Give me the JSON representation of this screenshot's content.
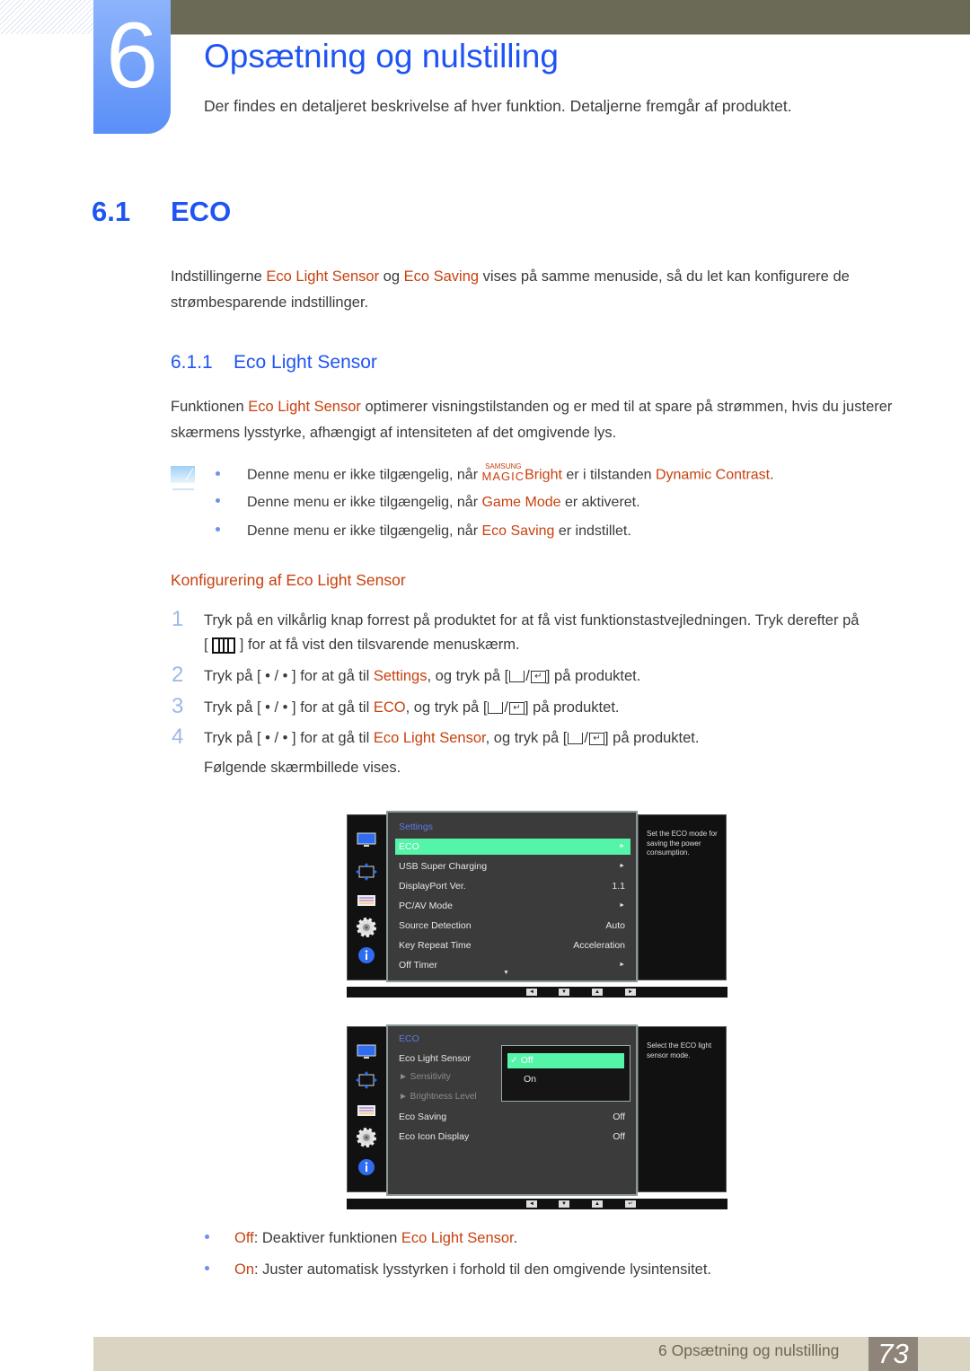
{
  "chapter": {
    "number": "6",
    "title": "Opsætning og nulstilling",
    "intro": "Der findes en detaljeret beskrivelse af hver funktion. Detaljerne fremgår af produktet."
  },
  "section": {
    "number": "6.1",
    "title": "ECO",
    "para": {
      "p1": "Indstillingerne ",
      "h1": "Eco Light Sensor",
      "p2": " og ",
      "h2": "Eco Saving",
      "p3": " vises på samme menuside, så du let kan konfigurere de strømbesparende indstillinger."
    }
  },
  "subsection": {
    "number": "6.1.1",
    "title": "Eco Light Sensor",
    "para": {
      "p1": "Funktionen ",
      "h1": "Eco Light Sensor",
      "p2": " optimerer visningstilstanden og er med til at spare på strømmen, hvis du justerer skærmens lysstyrke, afhængigt af intensiteten af det omgivende lys."
    }
  },
  "notes": [
    {
      "pre": "Denne menu er ikke tilgængelig, når ",
      "magic_top": "SAMSUNG",
      "magic_bottom": "MAGIC",
      "hl1": "Bright",
      "mid": " er i tilstanden ",
      "hl2": "Dynamic Contrast",
      "post": "."
    },
    {
      "pre": "Denne menu er ikke tilgængelig, når ",
      "hl1": "Game Mode",
      "post": " er aktiveret."
    },
    {
      "pre": "Denne menu er ikke tilgængelig, når ",
      "hl1": "Eco Saving",
      "post": " er indstillet."
    }
  ],
  "config": {
    "heading": "Konfigurering af Eco Light Sensor",
    "steps": [
      {
        "num": "1",
        "line1": "Tryk på en vilkårlig knap forrest på produktet for at få vist funktionstastvejledningen. Tryk derefter på",
        "line2_pre": "[",
        "line2_post": "] for at få vist den tilsvarende menuskærm."
      },
      {
        "num": "2",
        "pre": "Tryk på [ • / • ] for at gå til ",
        "hl": "Settings",
        "mid": ", og tryk på [",
        "post": "] på produktet."
      },
      {
        "num": "3",
        "pre": "Tryk på [ • / • ] for at gå til ",
        "hl": "ECO",
        "mid": ", og tryk på [",
        "post": "] på produktet."
      },
      {
        "num": "4",
        "pre": "Tryk på [ • / • ] for at gå til ",
        "hl": "Eco Light Sensor",
        "mid": ", og tryk på [",
        "post": "] på produktet."
      }
    ],
    "following": "Følgende skærmbillede vises."
  },
  "osd1": {
    "header": "Settings",
    "items": [
      {
        "label": "ECO",
        "value": "►",
        "selected": true
      },
      {
        "label": "USB Super Charging",
        "value": "►"
      },
      {
        "label": "DisplayPort Ver.",
        "value": "1.1"
      },
      {
        "label": "PC/AV Mode",
        "value": "►"
      },
      {
        "label": "Source Detection",
        "value": "Auto"
      },
      {
        "label": "Key Repeat Time",
        "value": "Acceleration"
      },
      {
        "label": "Off Timer",
        "value": "►"
      }
    ],
    "more": "▼",
    "help": "Set the ECO mode for saving the power consumption.",
    "nav": [
      "◄",
      "▼",
      "▲",
      "►"
    ]
  },
  "osd2": {
    "header": "ECO",
    "items": [
      {
        "label": "Eco Light Sensor",
        "value": ""
      },
      {
        "label": "► Sensitivity",
        "value": ""
      },
      {
        "label": "► Brightness Level",
        "value": ""
      },
      {
        "label": "Eco Saving",
        "value": "Off"
      },
      {
        "label": "Eco Icon Display",
        "value": "Off"
      }
    ],
    "options": [
      {
        "label": "Off",
        "check": "✓",
        "selected": true
      },
      {
        "label": "On",
        "check": ""
      }
    ],
    "help": "Select the ECO light sensor mode.",
    "nav": [
      "◄",
      "▼",
      "▲",
      "↵"
    ]
  },
  "options_desc": [
    {
      "hl": "Off",
      "text": ": Deaktiver funktionen ",
      "hl2": "Eco Light Sensor",
      "post": "."
    },
    {
      "hl": "On",
      "text": ": Juster automatisk lysstyrken i forhold til den omgivende lysintensitet.",
      "hl2": "",
      "post": ""
    }
  ],
  "footer": {
    "chapter": "6 Opsætning og nulstilling",
    "page": "73"
  },
  "colors": {
    "heading_blue": "#1f54f4",
    "highlight_orange": "#c8410f",
    "osd_select": "#54f5a9",
    "footer_bg": "#dad5c2"
  }
}
